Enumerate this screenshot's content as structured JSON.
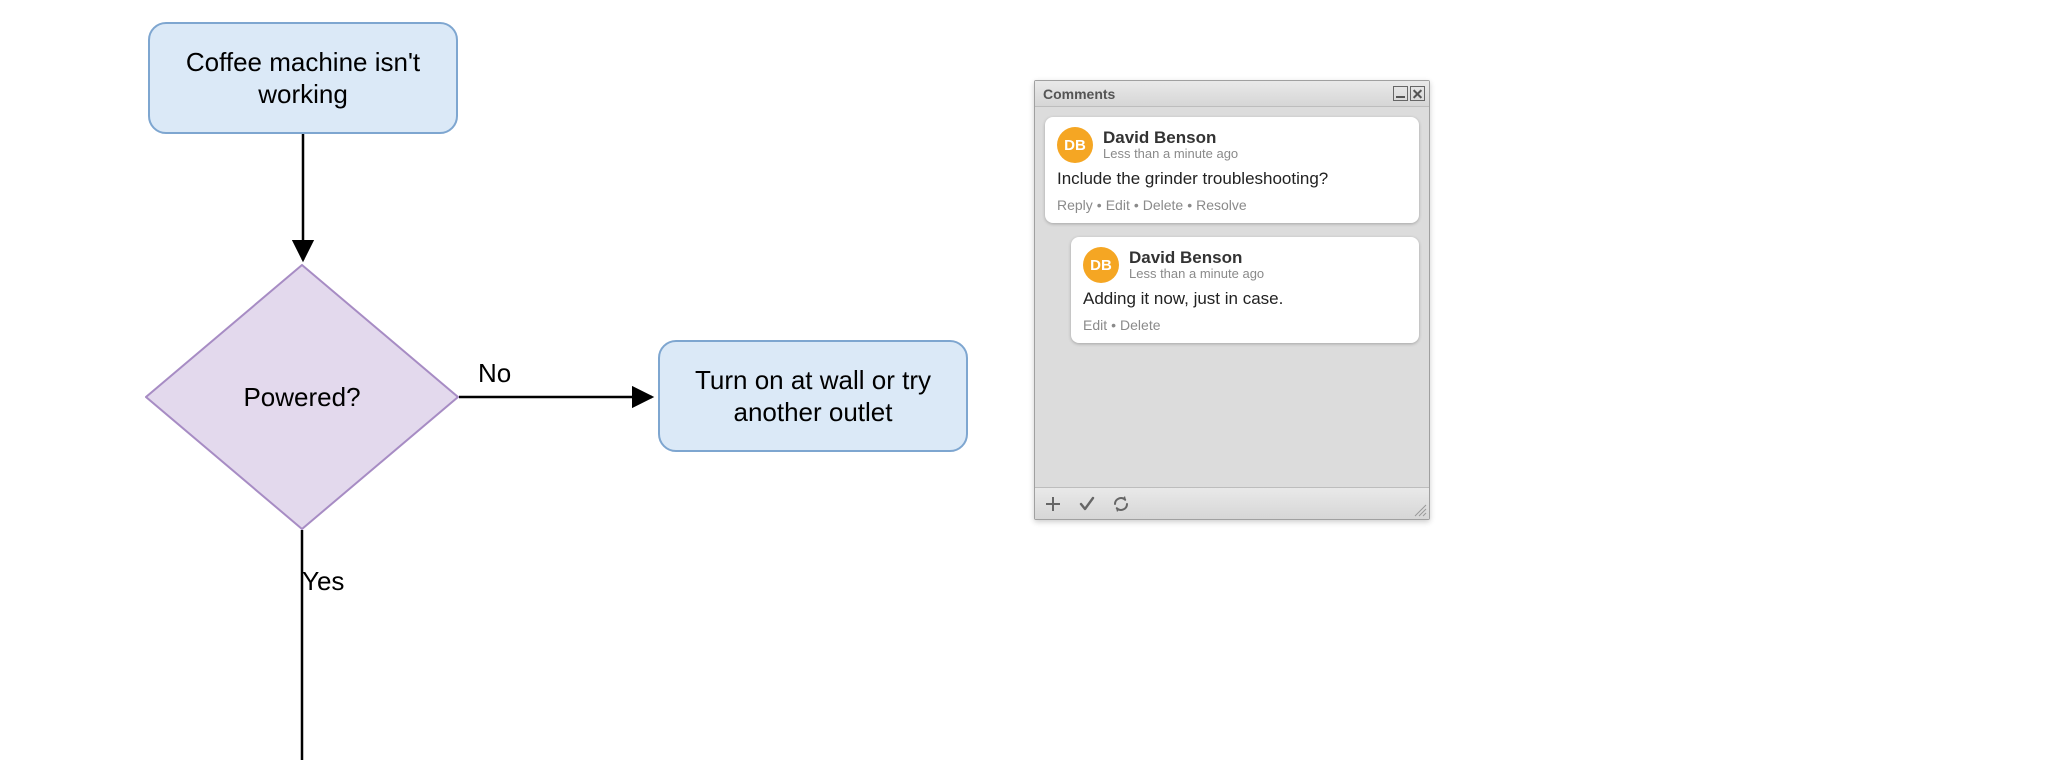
{
  "flowchart": {
    "start": "Coffee machine isn't working",
    "decision": "Powered?",
    "edge_no": "No",
    "edge_yes": "Yes",
    "action_no": "Turn on at wall or try another outlet"
  },
  "comments_panel": {
    "title": "Comments",
    "threads": [
      {
        "avatar_initials": "DB",
        "author": "David Benson",
        "time": "Less than a minute ago",
        "text": "Include the grinder troubleshooting?",
        "actions": {
          "reply": "Reply",
          "edit": "Edit",
          "delete": "Delete",
          "resolve": "Resolve"
        },
        "replies": [
          {
            "avatar_initials": "DB",
            "author": "David Benson",
            "time": "Less than a minute ago",
            "text": "Adding it now, just in case.",
            "actions": {
              "edit": "Edit",
              "delete": "Delete"
            }
          }
        ]
      }
    ]
  }
}
